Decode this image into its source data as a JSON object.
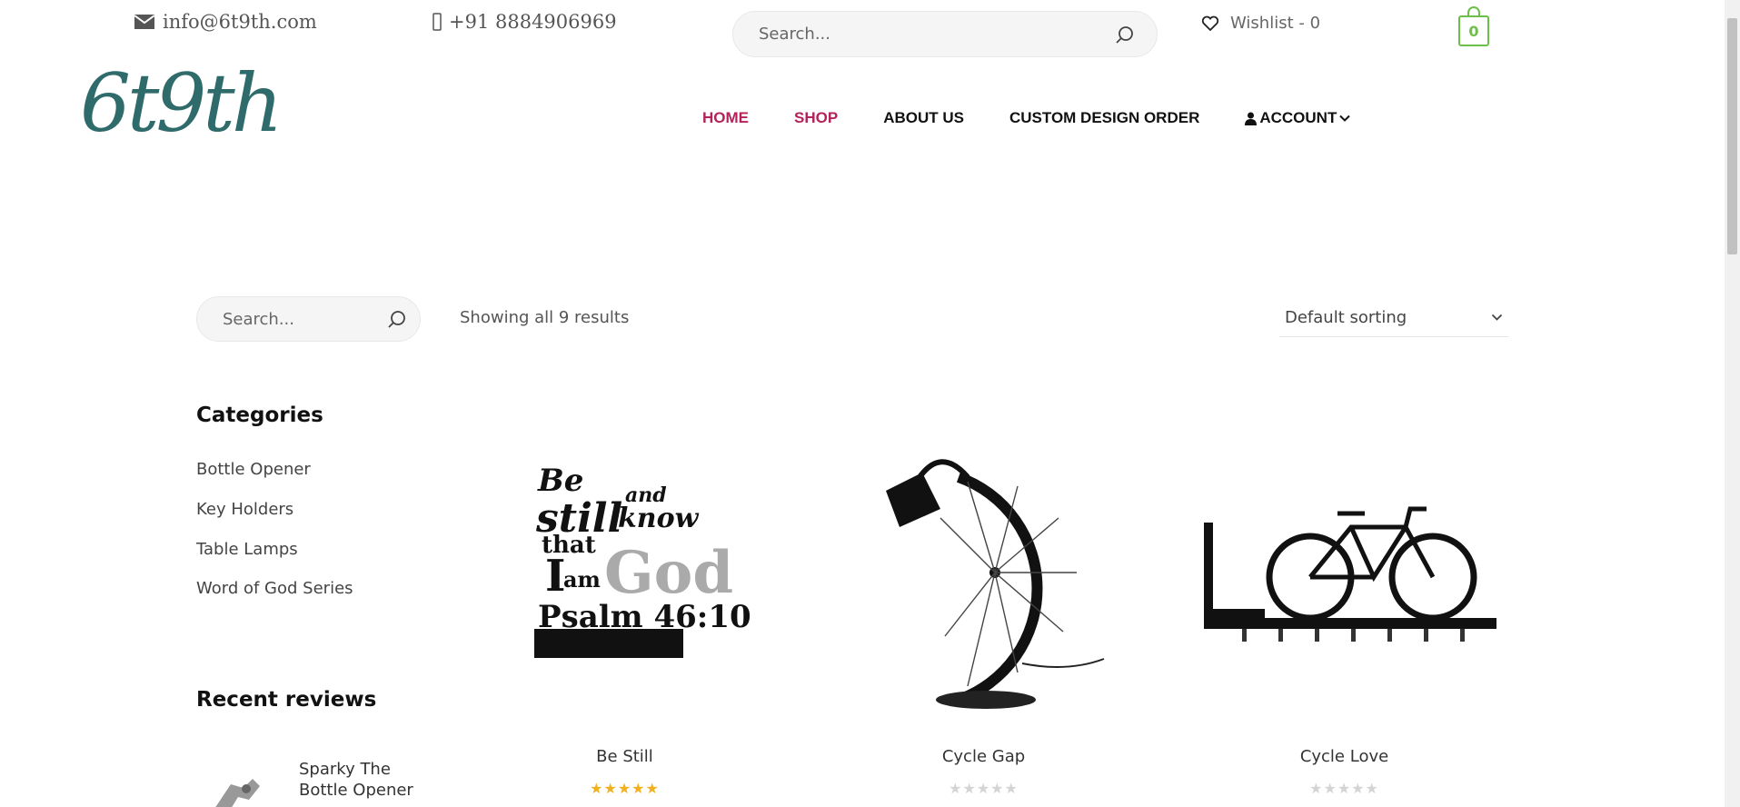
{
  "topbar": {
    "email": "info@6t9th.com",
    "phone": "+91 8884906969",
    "search_placeholder": "Search...",
    "wishlist_label": "Wishlist - 0",
    "cart_count": "0"
  },
  "logo": {
    "text": "6t9th"
  },
  "nav": {
    "items": [
      {
        "label": "HOME",
        "active": true
      },
      {
        "label": "SHOP",
        "active": true
      },
      {
        "label": "ABOUT US",
        "active": false
      },
      {
        "label": "CUSTOM DESIGN ORDER",
        "active": false
      },
      {
        "label": "ACCOUNT",
        "active": false
      }
    ]
  },
  "shop": {
    "search_placeholder": "Search...",
    "result_count": "Showing all 9 results",
    "sort_value": "Default sorting"
  },
  "sidebar": {
    "categories_heading": "Categories",
    "categories": [
      "Bottle Opener",
      "Key Holders",
      "Table Lamps",
      "Word of God Series"
    ],
    "recent_reviews_heading": "Recent reviews",
    "recent_review_item": "Sparky The Bottle Opener"
  },
  "products": [
    {
      "name": "Be Still",
      "rating": 5,
      "image_text": "Be still and know that I am God Psalm 46:10"
    },
    {
      "name": "Cycle Gap",
      "rating": 0
    },
    {
      "name": "Cycle Love",
      "rating": 0
    }
  ],
  "colors": {
    "accent": "#b3235a",
    "logo": "#2f6b6b",
    "cart": "#6cc04a",
    "star": "#f2b01e"
  }
}
